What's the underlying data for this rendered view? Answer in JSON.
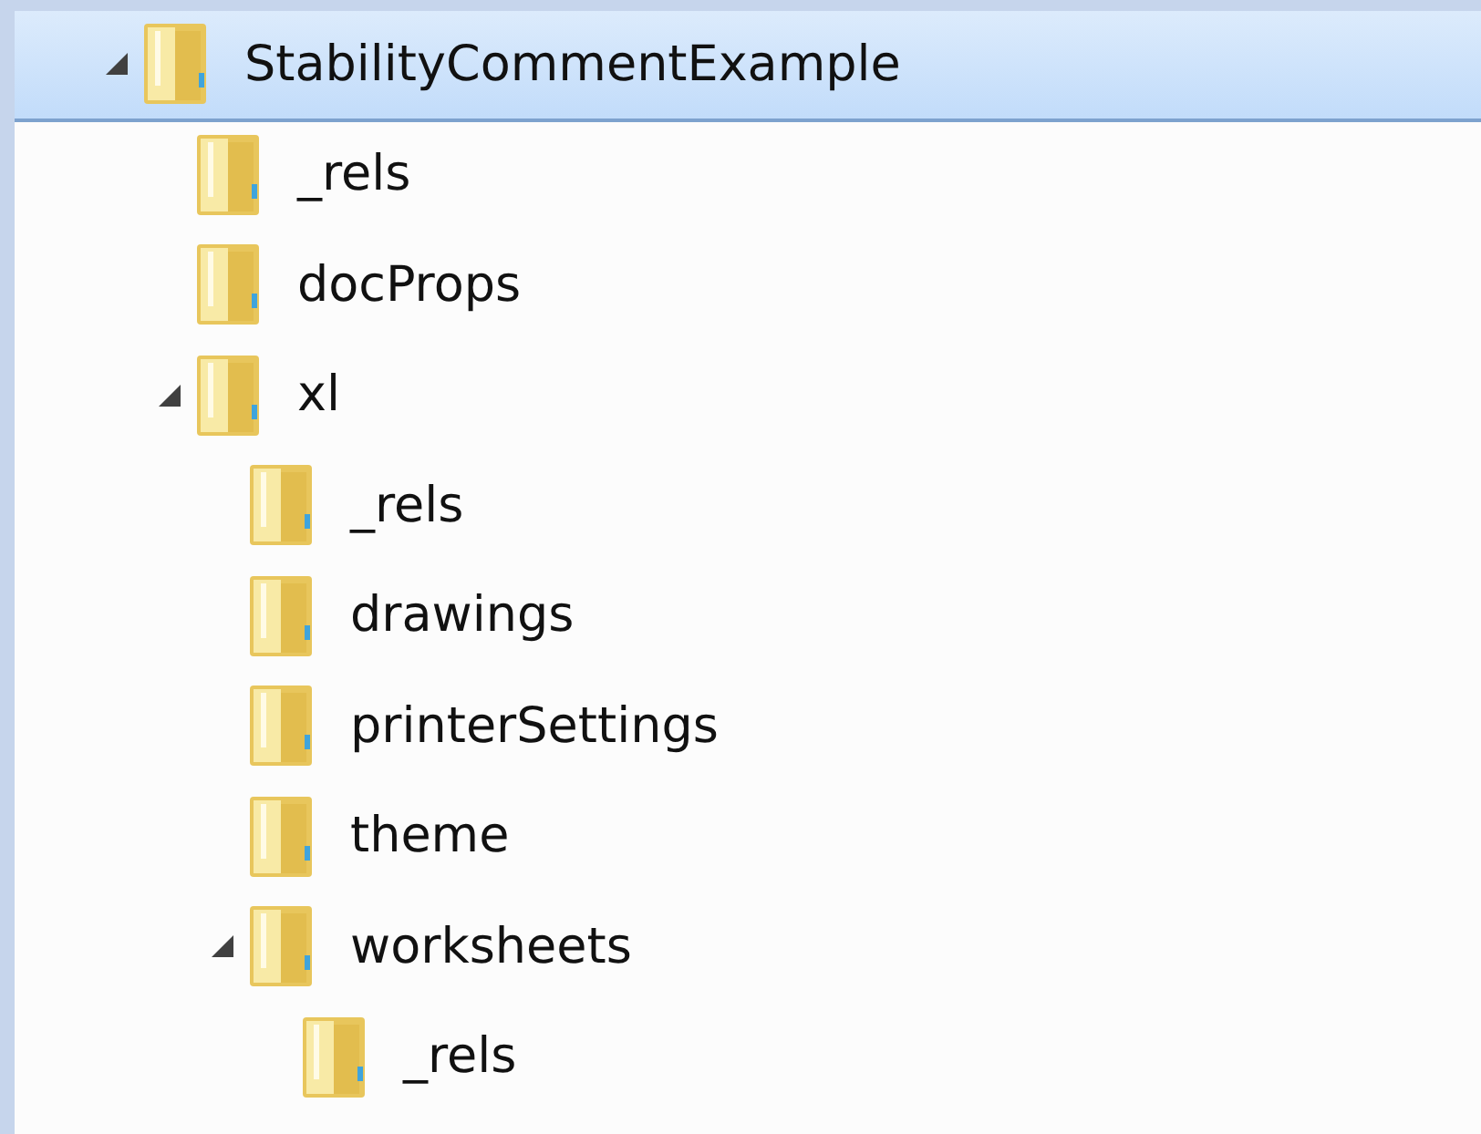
{
  "tree": [
    {
      "label": "StabilityCommentExample",
      "selected": true,
      "expanded": true,
      "children": [
        {
          "label": "_rels",
          "selected": false
        },
        {
          "label": "docProps",
          "selected": false
        },
        {
          "label": "xl",
          "selected": false,
          "expanded": true,
          "children": [
            {
              "label": "_rels",
              "selected": false
            },
            {
              "label": "drawings",
              "selected": false
            },
            {
              "label": "printerSettings",
              "selected": false
            },
            {
              "label": "theme",
              "selected": false
            },
            {
              "label": "worksheets",
              "selected": false,
              "expanded": true,
              "children": [
                {
                  "label": "_rels",
                  "selected": false
                }
              ]
            }
          ]
        }
      ]
    }
  ]
}
